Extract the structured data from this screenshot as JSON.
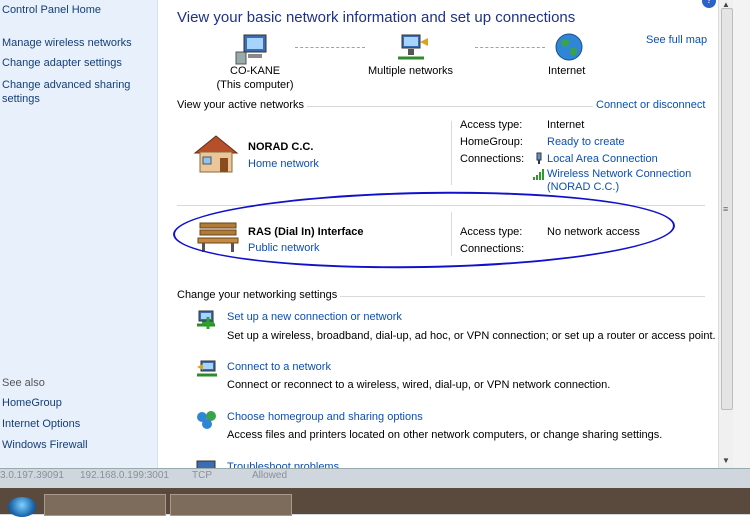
{
  "sidebar": {
    "home": "Control Panel Home",
    "links": [
      "Manage wireless networks",
      "Change adapter settings",
      "Change advanced sharing",
      "settings"
    ],
    "see_also_heading": "See also",
    "see_also": [
      "HomeGroup",
      "Internet Options",
      "Windows Firewall"
    ]
  },
  "main": {
    "title": "View your basic network information and set up connections",
    "see_full_map": "See full map",
    "map": {
      "computer_name": "CO-KANE",
      "computer_sub": "(This computer)",
      "middle": "Multiple networks",
      "internet": "Internet"
    },
    "active_heading": "View your active networks",
    "connect_disconnect": "Connect or disconnect",
    "networks": [
      {
        "name": "NORAD C.C.",
        "type": "Home network",
        "access_label": "Access type:",
        "access_value": "Internet",
        "homegroup_label": "HomeGroup:",
        "homegroup_value": "Ready to create",
        "connections_label": "Connections:",
        "connections": [
          "Local Area Connection",
          "Wireless Network Connection",
          "(NORAD C.C.)"
        ]
      },
      {
        "name": "RAS (Dial In) Interface",
        "type": "Public network",
        "access_label": "Access type:",
        "access_value": "No network access",
        "connections_label": "Connections:"
      }
    ],
    "settings_heading": "Change your networking settings",
    "tasks": [
      {
        "title": "Set up a new connection or network",
        "desc": "Set up a wireless, broadband, dial-up, ad hoc, or VPN connection; or set up a router or access point."
      },
      {
        "title": "Connect to a network",
        "desc": "Connect or reconnect to a wireless, wired, dial-up, or VPN network connection."
      },
      {
        "title": "Choose homegroup and sharing options",
        "desc": "Access files and printers located on other network computers, or change sharing settings."
      },
      {
        "title": "Troubleshoot problems"
      }
    ]
  },
  "footer": {
    "ghost_cells": [
      "3.0.197.39091",
      "192.168.0.199:3001",
      "TCP",
      "Allowed"
    ]
  },
  "icons": {
    "help": "help-icon",
    "scroll_up": "scroll-up-arrow-icon",
    "scroll_down": "scroll-down-arrow-icon"
  }
}
